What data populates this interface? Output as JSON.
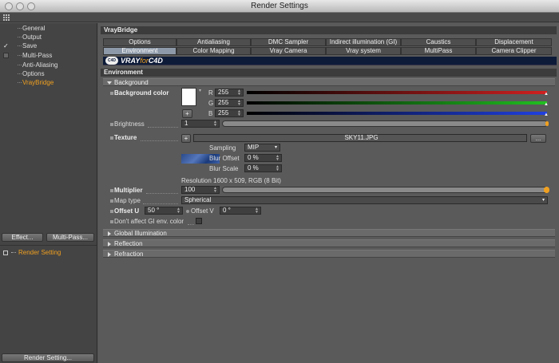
{
  "window": {
    "title": "Render Settings"
  },
  "sidebar": {
    "items": [
      {
        "label": "General"
      },
      {
        "label": "Output"
      },
      {
        "label": "Save"
      },
      {
        "label": "Multi-Pass"
      },
      {
        "label": "Anti-Aliasing"
      },
      {
        "label": "Options"
      },
      {
        "label": "VrayBridge"
      }
    ],
    "effect_btn": "Effect...",
    "multipass_btn": "Multi-Pass...",
    "render_setting_item": "Render Setting",
    "render_setting_btn": "Render Setting..."
  },
  "main": {
    "header": "VrayBridge",
    "tabs_row1": [
      "Options",
      "Antialiasing",
      "DMC Sampler",
      "Indirect illumination (GI)",
      "Caustics",
      "Displacement"
    ],
    "tabs_row2": [
      "Environment",
      "Color Mapping",
      "Vray Camera",
      "Vray system",
      "MultiPass",
      "Camera Clipper"
    ],
    "active_tab": "Environment",
    "logo": {
      "mark": "C4D",
      "text_vray": "VRAY",
      "text_for": "for",
      "text_c4d": "C4D"
    },
    "section_title": "Environment",
    "background_group": "Background",
    "bg_color_label": "Background color",
    "r_label": "R",
    "r_value": "255",
    "g_label": "G",
    "g_value": "255",
    "b_label": "B",
    "b_value": "255",
    "plus_label": "+",
    "brightness_label": "Brightness",
    "brightness_value": "1",
    "texture_label": "Texture",
    "texture_plus": "+",
    "texture_file": "SKY11.JPG",
    "texture_more": "...",
    "sampling_label": "Sampling",
    "sampling_value": "MIP",
    "blur_offset_label": "Blur Offset",
    "blur_offset_value": "0 %",
    "blur_scale_label": "Blur Scale",
    "blur_scale_value": "0 %",
    "resolution_text": "Resolution 1600 x 509, RGB (8 Bit)",
    "multiplier_label": "Multiplier",
    "multiplier_value": "100",
    "maptype_label": "Map type",
    "maptype_value": "Spherical",
    "offsetu_label": "Offset U",
    "offsetu_value": "50 °",
    "offsetv_label": "Offset V",
    "offsetv_value": "0 °",
    "dont_affect_label": "Don't affect GI env. color",
    "collapsed_groups": [
      "Global Illumination",
      "Reflection",
      "Refraction"
    ]
  },
  "colors": {
    "accent": "#f0a020",
    "red": "#d02020",
    "green": "#20c020",
    "blue": "#2040e0",
    "logo_bg": "#0d1b39"
  }
}
